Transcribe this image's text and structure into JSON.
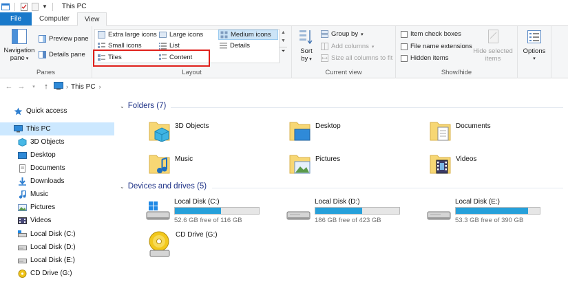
{
  "window": {
    "title": "This PC"
  },
  "tabs": [
    {
      "label": "File"
    },
    {
      "label": "Computer"
    },
    {
      "label": "View"
    }
  ],
  "ribbon": {
    "panes": {
      "navigation_pane": "Navigation\npane",
      "preview_pane": "Preview pane",
      "details_pane": "Details pane",
      "group_label": "Panes"
    },
    "layout": {
      "extra_large_icons": "Extra large icons",
      "large_icons": "Large icons",
      "medium_icons": "Medium icons",
      "small_icons": "Small icons",
      "list": "List",
      "details": "Details",
      "tiles": "Tiles",
      "content": "Content",
      "group_label": "Layout"
    },
    "current_view": {
      "sort_by": "Sort\nby",
      "group_by": "Group by",
      "add_columns": "Add columns",
      "size_all_columns": "Size all columns to fit",
      "group_label": "Current view"
    },
    "show_hide": {
      "item_check_boxes": "Item check boxes",
      "file_name_extensions": "File name extensions",
      "hidden_items": "Hidden items",
      "hide_selected_items": "Hide selected\nitems",
      "group_label": "Show/hide"
    },
    "options": {
      "label": "Options"
    }
  },
  "address": {
    "crumb": "This PC"
  },
  "sidebar": {
    "items": [
      {
        "label": "Quick access",
        "icon": "star-icon"
      },
      {
        "label": "This PC",
        "icon": "computer-icon"
      },
      {
        "label": "3D Objects",
        "icon": "cube-icon"
      },
      {
        "label": "Desktop",
        "icon": "desktop-icon"
      },
      {
        "label": "Documents",
        "icon": "document-icon"
      },
      {
        "label": "Downloads",
        "icon": "download-icon"
      },
      {
        "label": "Music",
        "icon": "music-icon"
      },
      {
        "label": "Pictures",
        "icon": "picture-icon"
      },
      {
        "label": "Videos",
        "icon": "video-icon"
      },
      {
        "label": "Local Disk (C:)",
        "icon": "drive-icon"
      },
      {
        "label": "Local Disk (D:)",
        "icon": "drive-icon"
      },
      {
        "label": "Local Disk (E:)",
        "icon": "drive-icon"
      },
      {
        "label": "CD Drive (G:)",
        "icon": "cd-icon"
      }
    ]
  },
  "main": {
    "folders_header": "Folders (7)",
    "folders": [
      {
        "name": "3D Objects"
      },
      {
        "name": "Desktop"
      },
      {
        "name": "Documents"
      },
      {
        "name": "Music"
      },
      {
        "name": "Pictures"
      },
      {
        "name": "Videos"
      }
    ],
    "drives_header": "Devices and drives (5)",
    "drives": [
      {
        "name": "Local Disk (C:)",
        "free": "52.6 GB free of 116 GB",
        "used_fraction": 0.55
      },
      {
        "name": "Local Disk (D:)",
        "free": "186 GB free of 423 GB",
        "used_fraction": 0.56
      },
      {
        "name": "Local Disk (E:)",
        "free": "53.3 GB free of 390 GB",
        "used_fraction": 0.86
      },
      {
        "name": "CD Drive (G:)"
      }
    ]
  },
  "colors": {
    "accent": "#1979ca",
    "selection": "#cce8ff",
    "bar_fill": "#26a0da",
    "highlight": "#e0201b"
  }
}
